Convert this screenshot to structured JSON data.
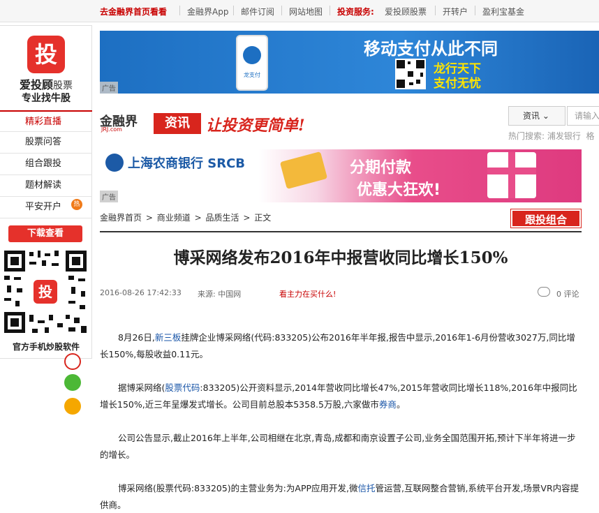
{
  "topnav": {
    "home_link": "去金融界首页看看",
    "items": [
      "金融界App",
      "邮件订阅",
      "网站地图"
    ],
    "invest_label": "投资服务:",
    "invest_items": [
      "爱投顾股票",
      "开转户",
      "盈利宝基金"
    ]
  },
  "leftpanel": {
    "logo_char": "投",
    "brand_bold": "爱投顾",
    "brand_thin": "股票",
    "subtitle": "专业找牛股",
    "menu": [
      "精彩直播",
      "股票问答",
      "组合跟投",
      "题材解读",
      "平安开户"
    ],
    "hot_badge": "热",
    "download_button": "下载查看",
    "qr_caption": "官方手机炒股软件"
  },
  "banner_top": {
    "ad_label": "广告",
    "title": "移动支付从此不同",
    "line1": "龙行天下",
    "line2": "支付无忧",
    "phone_text": "龙支付"
  },
  "header": {
    "site_name": "金融界",
    "site_domain": "JRJ.com",
    "section": "资讯",
    "slogan": "让投资更简单!"
  },
  "search": {
    "select_label": "资讯",
    "placeholder": "请输入",
    "hot_label": "热门搜索:",
    "hot_items": [
      "浦发银行",
      "格"
    ]
  },
  "banner_mid": {
    "ad_label": "广告",
    "bank_name": "上海农商银行 SRCB",
    "line1": "分期付款",
    "line2": "优惠大狂欢!"
  },
  "breadcrumb": [
    "金融界首页",
    "商业频道",
    "品质生活",
    "正文"
  ],
  "follow_button": "跟投组合",
  "article": {
    "title": "博采网络发布2016年中报营收同比增长150%",
    "datetime": "2016-08-26 17:42:33",
    "source": "来源: 中国网",
    "promo": "看主力在买什么!",
    "comment_count": "0",
    "comment_label": "评论",
    "p1_a": "8月26日,",
    "p1_link": "新三板",
    "p1_b": "挂牌企业博采网络(代码:833205)公布2016年半年报,报告中显示,2016年1-6月份营收3027万,同比增长150%,每股收益0.11元。",
    "p2_a": "据博采网络(",
    "p2_link": "股票代码",
    "p2_b": ":833205)公开资料显示,2014年营收同比增长47%,2015年营收同比增长118%,2016年中报同比增长150%,近三年呈爆发式增长。公司目前总股本5358.5万股,六家做市",
    "p2_link2": "券商",
    "p2_c": "。",
    "p3": "公司公告显示,截止2016年上半年,公司相继在北京,青岛,成都和南京设置子公司,业务全国范围开拓,预计下半年将进一步的增长。",
    "p4_a": "博采网络(股票代码:833205)的主营业务为:为APP应用开发,微",
    "p4_link": "信托",
    "p4_b": "管运营,互联网整合营销,系统平台开发,场景VR内容提供商。"
  },
  "colors": {
    "brand_red": "#d8251d",
    "link_blue": "#1a56a8"
  }
}
